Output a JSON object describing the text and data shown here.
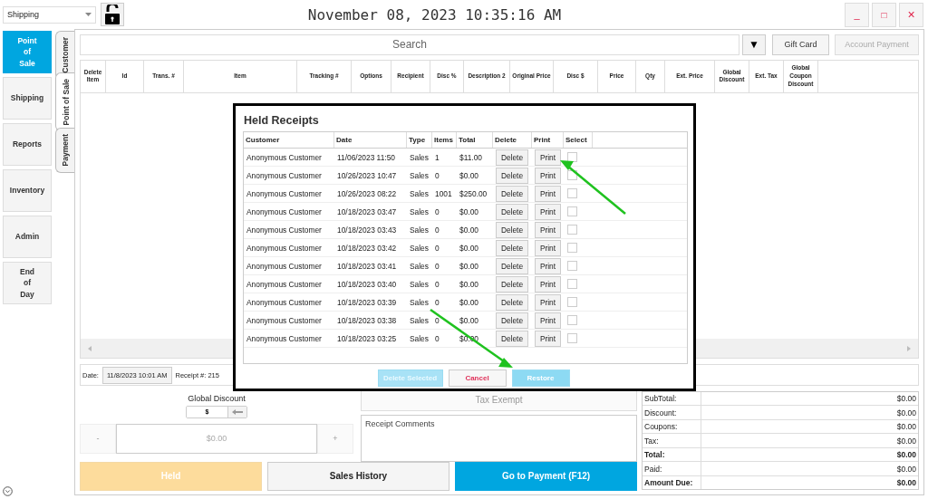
{
  "toolbar": {
    "mode_select": "Shipping",
    "clock": "November 08, 2023 10:35:16 AM",
    "locked": false
  },
  "window_controls": [
    {
      "symbol": "_",
      "kind": "minimize"
    },
    {
      "symbol": "□",
      "kind": "maximize"
    },
    {
      "symbol": "×",
      "kind": "close"
    }
  ],
  "nav": [
    {
      "label": "Point\nof\nSale",
      "selected": true
    },
    {
      "label": "Shipping",
      "selected": false
    },
    {
      "label": "Reports",
      "selected": false
    },
    {
      "label": "Inventory",
      "selected": false
    },
    {
      "label": "Admin",
      "selected": false
    },
    {
      "label": "End\nof\nDay",
      "selected": false
    }
  ],
  "side_tabs": [
    {
      "label": "Customer",
      "selected": false
    },
    {
      "label": "Point of Sale",
      "selected": true
    },
    {
      "label": "Payment",
      "selected": false
    }
  ],
  "search": {
    "placeholder": "Search",
    "dropdown": "▼"
  },
  "search_buttons": [
    {
      "label": "Gift Card"
    },
    {
      "label": "Account Payment",
      "disabled": true
    }
  ],
  "table": {
    "columns": [
      "Delete Item",
      "Id",
      "Trans. #",
      "Item",
      "Tracking #",
      "Options",
      "Recipient",
      "Disc %",
      "Description 2",
      "Original Price",
      "Disc $",
      "Price",
      "Qty",
      "Ext. Price",
      "Global Discount",
      "Ext. Tax",
      "Global Coupon Discount"
    ]
  },
  "receipt_info": {
    "date_label": "Date:",
    "date": "11/8/2023 10:01 AM",
    "receipt_label": "Receipt #: 215"
  },
  "global_discount": {
    "label": "Global Discount",
    "unit": "$",
    "amount": "$0.00",
    "minus": "-",
    "plus": "+"
  },
  "tax_exempt": {
    "label": "Tax Exempt",
    "disabled": true
  },
  "comments": {
    "placeholder": "Receipt Comments"
  },
  "actions": [
    {
      "label": "Held",
      "kind": "held",
      "disabled": true
    },
    {
      "label": "Sales History",
      "kind": "plain"
    },
    {
      "label": "Go to Payment (F12)",
      "kind": "primary"
    }
  ],
  "totals": [
    {
      "label": "SubTotal:",
      "value": "$0.00",
      "bold": false
    },
    {
      "label": "Discount:",
      "value": "$0.00",
      "bold": false
    },
    {
      "label": "Coupons:",
      "value": "$0.00",
      "bold": false
    },
    {
      "label": "Tax:",
      "value": "$0.00",
      "bold": false
    },
    {
      "label": "Total:",
      "value": "$0.00",
      "bold": true
    },
    {
      "label": "Paid:",
      "value": "$0.00",
      "bold": false
    },
    {
      "label": "Amount Due:",
      "value": "$0.00",
      "bold": true
    }
  ],
  "dialog": {
    "title": "Held Receipts",
    "columns": [
      "Customer",
      "Date",
      "Type",
      "Items",
      "Total",
      "Delete",
      "Print",
      "Select"
    ],
    "rows": [
      {
        "customer": "Anonymous Customer",
        "date": "11/06/2023 11:50",
        "type": "Sales",
        "items": "1",
        "total": "$11.00",
        "delete": "Delete",
        "print": "Print",
        "selected": false
      },
      {
        "customer": "Anonymous Customer",
        "date": "10/26/2023 10:47",
        "type": "Sales",
        "items": "0",
        "total": "$0.00",
        "delete": "Delete",
        "print": "Print",
        "selected": false
      },
      {
        "customer": "Anonymous Customer",
        "date": "10/26/2023 08:22",
        "type": "Sales",
        "items": "1001",
        "total": "$250.00",
        "delete": "Delete",
        "print": "Print",
        "selected": false
      },
      {
        "customer": "Anonymous Customer",
        "date": "10/18/2023 03:47",
        "type": "Sales",
        "items": "0",
        "total": "$0.00",
        "delete": "Delete",
        "print": "Print",
        "selected": false
      },
      {
        "customer": "Anonymous Customer",
        "date": "10/18/2023 03:43",
        "type": "Sales",
        "items": "0",
        "total": "$0.00",
        "delete": "Delete",
        "print": "Print",
        "selected": false
      },
      {
        "customer": "Anonymous Customer",
        "date": "10/18/2023 03:42",
        "type": "Sales",
        "items": "0",
        "total": "$0.00",
        "delete": "Delete",
        "print": "Print",
        "selected": false
      },
      {
        "customer": "Anonymous Customer",
        "date": "10/18/2023 03:41",
        "type": "Sales",
        "items": "0",
        "total": "$0.00",
        "delete": "Delete",
        "print": "Print",
        "selected": false
      },
      {
        "customer": "Anonymous Customer",
        "date": "10/18/2023 03:40",
        "type": "Sales",
        "items": "0",
        "total": "$0.00",
        "delete": "Delete",
        "print": "Print",
        "selected": false
      },
      {
        "customer": "Anonymous Customer",
        "date": "10/18/2023 03:39",
        "type": "Sales",
        "items": "0",
        "total": "$0.00",
        "delete": "Delete",
        "print": "Print",
        "selected": false
      },
      {
        "customer": "Anonymous Customer",
        "date": "10/18/2023 03:38",
        "type": "Sales",
        "items": "0",
        "total": "$0.00",
        "delete": "Delete",
        "print": "Print",
        "selected": false
      },
      {
        "customer": "Anonymous Customer",
        "date": "10/18/2023 03:25",
        "type": "Sales",
        "items": "0",
        "total": "$0.00",
        "delete": "Delete",
        "print": "Print",
        "selected": false
      }
    ],
    "buttons": [
      {
        "label": "Delete Selected",
        "kind": "primary",
        "disabled": true
      },
      {
        "label": "Cancel",
        "kind": "cancel"
      },
      {
        "label": "Restore",
        "kind": "primary"
      }
    ]
  }
}
